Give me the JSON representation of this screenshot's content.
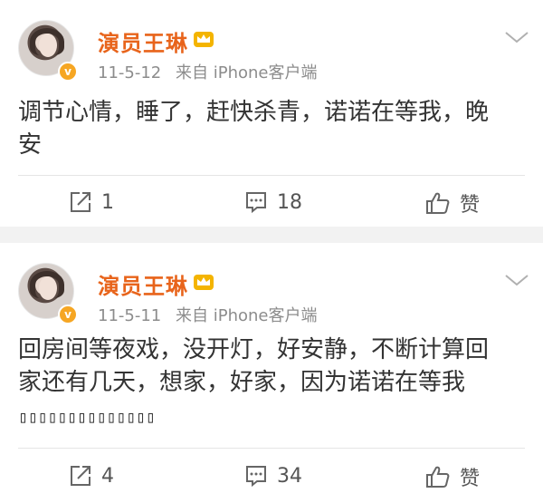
{
  "posts": [
    {
      "author": "演员王琳",
      "timestamp": "11-5-12",
      "source": "来自 iPhone客户端",
      "text": "调节心情，睡了，赶快杀青，诺诺在等我，晚安",
      "text_line1": "调节心情，睡了，赶快杀青，诺诺在等我，晚",
      "text_line2": "安",
      "repost_count": "1",
      "comment_count": "18",
      "like_label": "赞",
      "verified_badge": "v"
    },
    {
      "author": "演员王琳",
      "timestamp": "11-5-11",
      "source": "来自 iPhone客户端",
      "text": "回房间等夜戏，没开灯，好安静，不断计算回家还有几天，想家，好家，因为诺诺在等我",
      "text_line1": "回房间等夜戏，没开灯，好安静，不断计算回",
      "text_line2": "家还有几天，想家，好家，因为诺诺在等我",
      "garbled_line": "▯▯▯▯▯▯▯▯▯▯▯▯▯▯",
      "repost_count": "4",
      "comment_count": "34",
      "like_label": "赞",
      "verified_badge": "v"
    }
  ],
  "icons": {
    "crown": "crown-icon",
    "chevron": "chevron-down-icon",
    "repost": "repost-icon",
    "comment": "comment-icon",
    "like": "thumbs-up-icon"
  },
  "colors": {
    "author": "#e8641b",
    "meta": "#8c8c8c",
    "text": "#333333",
    "badge": "#f6a623",
    "background": "#f2f2f2"
  }
}
